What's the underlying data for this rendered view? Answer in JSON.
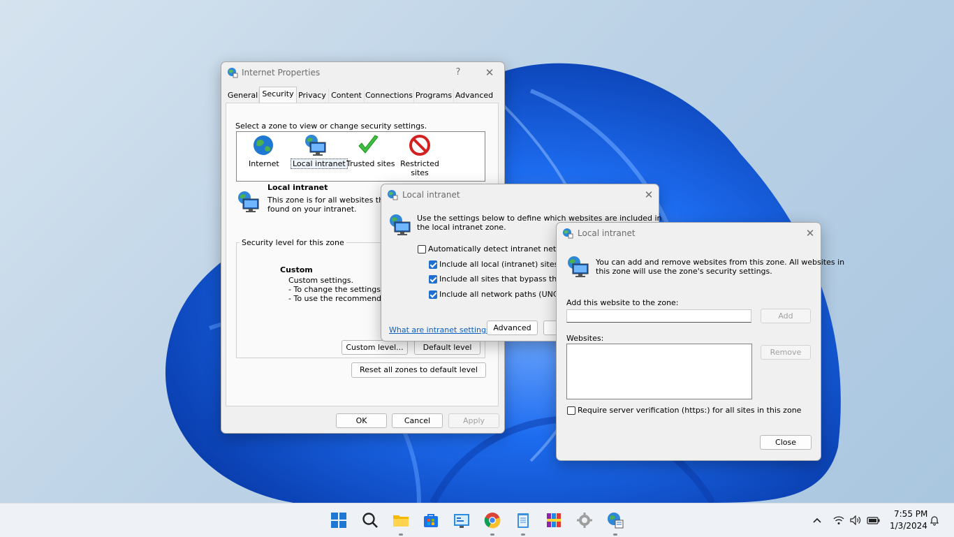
{
  "colors": {
    "accent": "#1f6fd0",
    "desktop": "#bcd2e6",
    "bloom": "#0a55d6"
  },
  "main_dialog": {
    "title": "Internet Properties",
    "help_glyph": "?",
    "close_glyph": "✕",
    "tabs": [
      "General",
      "Security",
      "Privacy",
      "Content",
      "Connections",
      "Programs",
      "Advanced"
    ],
    "selected_tab": "Security",
    "zone_prompt": "Select a zone to view or change security settings.",
    "zones": [
      {
        "label": "Internet",
        "icon": "globe-icon"
      },
      {
        "label": "Local intranet",
        "icon": "intranet-icon"
      },
      {
        "label": "Trusted sites",
        "icon": "checkmark-icon"
      },
      {
        "label": "Restricted sites",
        "icon": "restricted-icon"
      }
    ],
    "zone_heading": "Local intranet",
    "zone_desc_line1": "This zone is for all websites that ar",
    "zone_desc_line2": "found on your intranet.",
    "security_group_label": "Security level for this zone",
    "level_heading": "Custom",
    "level_line1": "Custom settings.",
    "level_line2": "- To change the settings, cli",
    "level_line3": "- To use the recommended s",
    "custom_level_button": "Custom level...",
    "default_level_button": "Default level",
    "reset_button": "Reset all zones to default level",
    "ok_button": "OK",
    "cancel_button": "Cancel",
    "apply_button": "Apply"
  },
  "intranet_dialog": {
    "title": "Local intranet",
    "close_glyph": "✕",
    "intro_line1": "Use the settings below to define which websites are included in",
    "intro_line2": "the local intranet zone.",
    "options": [
      {
        "label": "Automatically detect intranet network",
        "checked": false
      },
      {
        "label": "Include all local (intranet) sites not",
        "checked": true
      },
      {
        "label": "Include all sites that bypass the pro",
        "checked": true
      },
      {
        "label": "Include all network paths (UNCs)",
        "checked": true
      }
    ],
    "help_link": "What are intranet settings?",
    "advanced_button": "Advanced"
  },
  "sites_dialog": {
    "title": "Local intranet",
    "close_glyph": "✕",
    "intro_line1": "You can add and remove websites from this zone. All websites in",
    "intro_line2": "this zone will use the zone's security settings.",
    "add_label": "Add this website to the zone:",
    "add_value": "",
    "add_button": "Add",
    "websites_label": "Websites:",
    "remove_button": "Remove",
    "require_https_label": "Require server verification (https:) for all sites in this zone",
    "require_https_checked": false,
    "close_button": "Close"
  },
  "taskbar": {
    "apps": [
      "windows-start-icon",
      "search-icon",
      "file-explorer-icon",
      "microsoft-store-icon",
      "control-panel-icon",
      "chrome-icon",
      "notepad-icon",
      "winrar-icon",
      "settings-app-icon",
      "internet-options-icon"
    ],
    "time": "7:55 PM",
    "date": "1/3/2024"
  }
}
